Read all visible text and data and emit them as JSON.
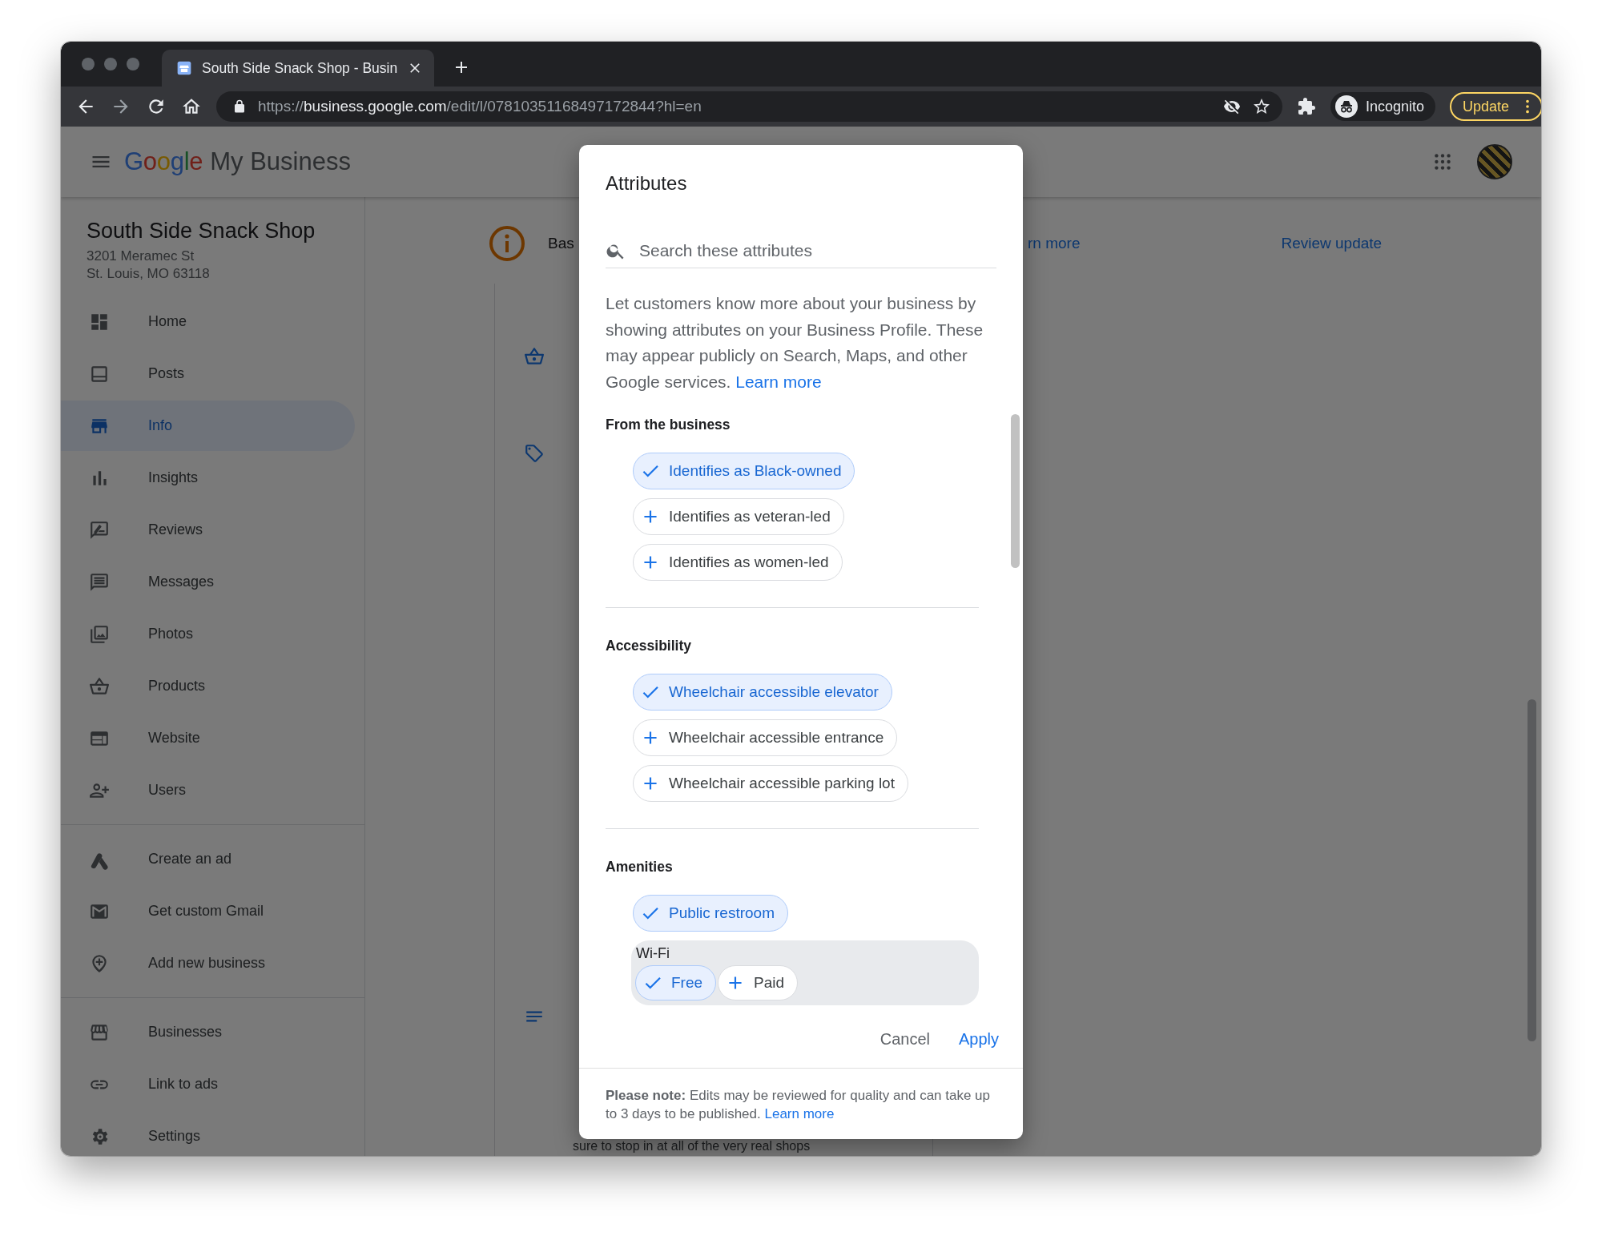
{
  "browser": {
    "tab_title": "South Side Snack Shop - Busin",
    "url_scheme": "https://",
    "url_host": "business.google.com",
    "url_path": "/edit/l/07810351168497172844?hl=en",
    "profile_label": "Incognito",
    "update_label": "Update"
  },
  "header": {
    "logo": "Google",
    "product": "My Business"
  },
  "sidebar": {
    "business_name": "South Side Snack Shop",
    "address_lines": [
      "3201 Meramec St",
      "St. Louis, MO 63118"
    ],
    "groups": [
      [
        {
          "label": "Home",
          "selected": false
        },
        {
          "label": "Posts",
          "selected": false
        },
        {
          "label": "Info",
          "selected": true
        },
        {
          "label": "Insights",
          "selected": false
        },
        {
          "label": "Reviews",
          "selected": false
        },
        {
          "label": "Messages",
          "selected": false
        },
        {
          "label": "Photos",
          "selected": false
        },
        {
          "label": "Products",
          "selected": false
        },
        {
          "label": "Website",
          "selected": false
        },
        {
          "label": "Users",
          "selected": false
        }
      ],
      [
        {
          "label": "Create an ad",
          "selected": false
        },
        {
          "label": "Get custom Gmail",
          "selected": false
        },
        {
          "label": "Add new business",
          "selected": false
        }
      ],
      [
        {
          "label": "Businesses",
          "selected": false
        },
        {
          "label": "Link to ads",
          "selected": false
        },
        {
          "label": "Settings",
          "selected": false
        }
      ]
    ]
  },
  "main": {
    "banner_text": "Bas",
    "banner_link": "rn more",
    "review_link": "Review update",
    "body_line": "sure to stop in at all of the very real shops"
  },
  "dialog": {
    "title": "Attributes",
    "search": {
      "placeholder": "Search these attributes"
    },
    "description": "Let customers know more about your business by showing attributes on your Business Profile. These may appear publicly on Search, Maps, and other Google services.",
    "description_link": "Learn more",
    "sections": [
      {
        "heading": "From the business",
        "items": [
          {
            "kind": "chip",
            "label": "Identifies as Black-owned",
            "selected": true
          },
          {
            "kind": "chip",
            "label": "Identifies as veteran-led",
            "selected": false
          },
          {
            "kind": "chip",
            "label": "Identifies as women-led",
            "selected": false
          }
        ]
      },
      {
        "heading": "Accessibility",
        "items": [
          {
            "kind": "chip",
            "label": "Wheelchair accessible elevator",
            "selected": true
          },
          {
            "kind": "chip",
            "label": "Wheelchair accessible entrance",
            "selected": false
          },
          {
            "kind": "chip",
            "label": "Wheelchair accessible parking lot",
            "selected": false
          }
        ]
      },
      {
        "heading": "Amenities",
        "items": [
          {
            "kind": "chip",
            "label": "Public restroom",
            "selected": true
          },
          {
            "kind": "group",
            "label": "Wi-Fi",
            "options": [
              {
                "label": "Free",
                "selected": true
              },
              {
                "label": "Paid",
                "selected": false
              }
            ]
          }
        ]
      }
    ],
    "buttons": [
      {
        "kind": "text",
        "label": "Cancel"
      },
      {
        "kind": "primary",
        "label": "Apply"
      }
    ],
    "note": "**Please note:** Edits may be reviewed for quality and can take up to 3 days to be published.",
    "note_link": "Learn more"
  }
}
